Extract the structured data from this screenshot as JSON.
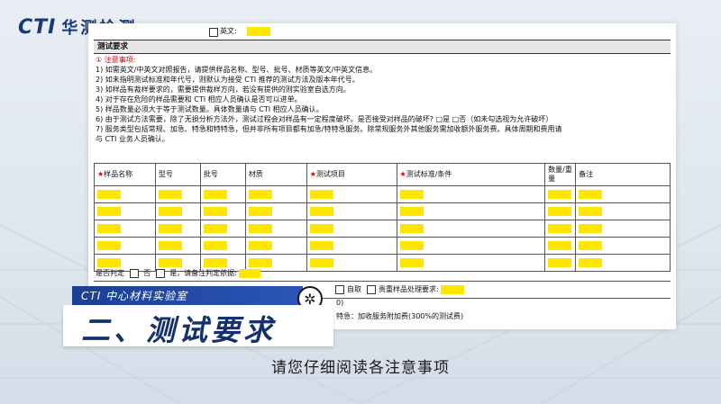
{
  "logo": {
    "cti": "CTI",
    "cn": "华测检测"
  },
  "document": {
    "top_checkbox_label": "英文:",
    "section_title": "测试要求",
    "notes_head": "① 注意事项:",
    "notes": [
      "1) 如需英文/中英文对照报告，请提供样品名称、型号、批号、材质等英文/中英文信息。",
      "2) 如未指明测试标准和年代号，则默认为接受 CTI 推荐的测试方法及版本年代号。",
      "3) 如样品有裁样要求的，需要提供裁样方向，若没有提供的则实验室自选方向。",
      "4) 对于存在危险的样品需要和 CTI 相应人员确认是否可以进单。",
      "5) 样品数量必须大于等于测试数量。具体数量请与 CTI 相应人员确认。",
      "6) 由于测试方法需要，除了无损分析方法外，测试过程会对样品有一定程度破坏。是否接受对样品的破坏?  □是    □否（如未勾选视为允许破坏）",
      "7) 服务类型包括常规、加急、特急和特特急，但并非所有项目都有加急/特特急服务。除常规服务外其他服务需加收额外服务费。具体周期和费用请",
      "    与 CTI 业务人员确认。"
    ],
    "table": {
      "headers": [
        "样品名称",
        "型号",
        "批号",
        "材质",
        "测试项目",
        "测试标准/条件",
        "数量/重量",
        "备注"
      ],
      "starred": [
        true,
        false,
        false,
        false,
        true,
        true,
        false,
        false
      ],
      "row_count": 5
    },
    "judge": {
      "label": "是否判定",
      "no": "否",
      "yes": "是，请备注判定依据:"
    },
    "row2": {
      "left": "",
      "return_label": "自取",
      "precious": "贵重样品处理要求:"
    },
    "row3": "0)",
    "row4": "特急：加收服务附加费(300%的测试费)"
  },
  "tag": "CTI 中心材料实验室",
  "banner": "二、测试要求",
  "subtitle": "请您仔细阅读各注意事项",
  "colors": {
    "highlight": "#ffe600",
    "brand": "#16397a",
    "tag_blue": "#1c3f93"
  }
}
